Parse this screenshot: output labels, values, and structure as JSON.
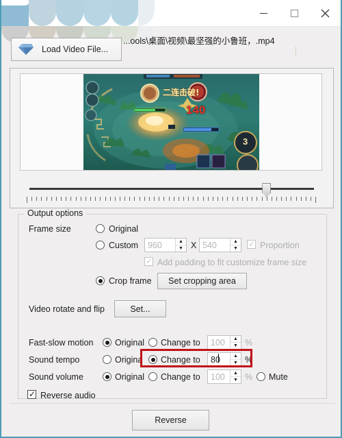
{
  "window": {
    "title": "",
    "minimize_label": "Minimize",
    "maximize_label": "Maximize",
    "close_label": "Close",
    "border_color": "#4f9bb5"
  },
  "toolbar": {
    "load_button_label": "Load Video File...",
    "file_path": "...ools\\桌面\\视频\\最坚强的小鲁班，.mp4"
  },
  "preview": {
    "slider_value": 83,
    "kill_text": "二连击破!",
    "damage_value": "140",
    "counter_value": "3"
  },
  "output_options": {
    "group_title": "Output options",
    "frame_size_label": "Frame size",
    "original_label": "Original",
    "custom_label": "Custom",
    "width_value": "960",
    "x_label": "X",
    "height_value": "540",
    "proportion_label": "Proportion",
    "padding_label": "Add padding to fit customize frame size",
    "crop_frame_label": "Crop frame",
    "set_cropping_label": "Set cropping area",
    "rotate_flip_label": "Video rotate and flip",
    "set_button_label": "Set..."
  },
  "audio_video": {
    "fast_slow_label": "Fast-slow motion",
    "fast_slow_original": "Original",
    "fast_slow_change": "Change to",
    "fast_slow_value": "100",
    "fast_slow_unit": "%",
    "tempo_label": "Sound tempo",
    "tempo_original": "Origina",
    "tempo_change": "Change to",
    "tempo_value": "80",
    "tempo_unit": "%",
    "volume_label": "Sound volume",
    "volume_original": "Original",
    "volume_change": "Change to",
    "volume_value": "100",
    "volume_unit": "%",
    "mute_label": "Mute",
    "reverse_audio_label": "Reverse audio",
    "highlight_color": "#c1121a"
  },
  "footer": {
    "reverse_button_label": "Reverse"
  }
}
